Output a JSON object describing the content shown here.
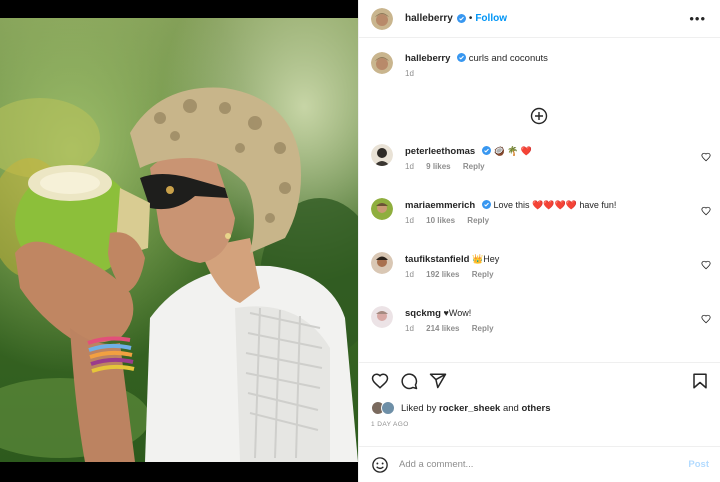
{
  "post": {
    "author": "halleberry",
    "follow_label": "Follow",
    "more_label": "•••",
    "separator": "•"
  },
  "caption": {
    "username": "halleberry",
    "text": "curls and coconuts",
    "time": "1d"
  },
  "comments": [
    {
      "username": "peterleethomas",
      "text": "🥥 🌴 ❤️",
      "time": "1d",
      "likes": "9 likes",
      "reply": "Reply",
      "verified": true
    },
    {
      "username": "mariaemmerich",
      "text": "Love this ❤️❤️❤️❤️ have fun!",
      "time": "1d",
      "likes": "10 likes",
      "reply": "Reply",
      "verified": true
    },
    {
      "username": "taufikstanfield",
      "text": "👑Hey",
      "time": "1d",
      "likes": "192 likes",
      "reply": "Reply",
      "verified": false
    },
    {
      "username": "sqckmg",
      "text": "♥Wow!",
      "time": "1d",
      "likes": "214 likes",
      "reply": "Reply",
      "verified": false
    }
  ],
  "liked_by": {
    "prefix": "Liked by",
    "user": "rocker_sheek",
    "conj": "and",
    "others": "others"
  },
  "date_label": "1 DAY AGO",
  "add_comment": {
    "placeholder": "Add a comment...",
    "post_label": "Post"
  },
  "colors": {
    "link_blue": "#0095f6",
    "post_disabled": "#b3dbff",
    "muted": "#8e8e8e",
    "heart_red": "#ed4956"
  },
  "icons": [
    "verified-badge-icon",
    "more-options-icon",
    "add-circle-icon",
    "heart-icon",
    "comment-icon",
    "share-icon",
    "bookmark-icon",
    "emoji-icon"
  ]
}
